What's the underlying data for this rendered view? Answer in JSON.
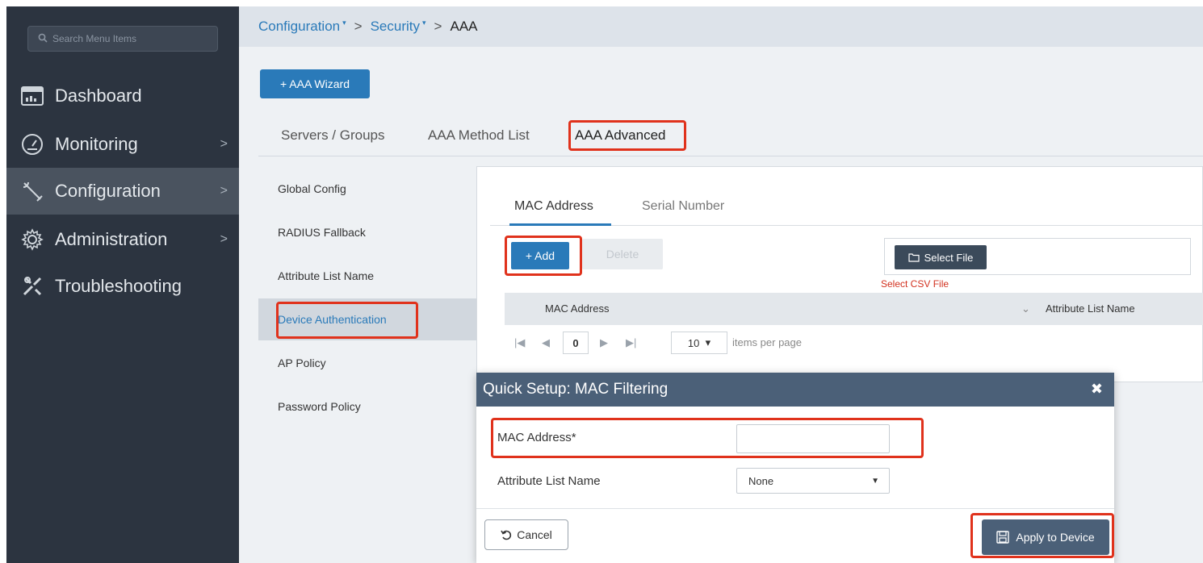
{
  "sidebar": {
    "search_placeholder": "Search Menu Items",
    "items": [
      {
        "label": "Dashboard",
        "icon": "dashboard-icon",
        "chevron": ""
      },
      {
        "label": "Monitoring",
        "icon": "gauge-icon",
        "chevron": ">"
      },
      {
        "label": "Configuration",
        "icon": "wrench-icon",
        "chevron": ">"
      },
      {
        "label": "Administration",
        "icon": "gear-icon",
        "chevron": ">"
      },
      {
        "label": "Troubleshooting",
        "icon": "tools-icon",
        "chevron": ""
      }
    ]
  },
  "breadcrumb": {
    "items": [
      "Configuration",
      "Security"
    ],
    "current": "AAA",
    "separator": ">"
  },
  "wizard_button": "+ AAA Wizard",
  "tabs": [
    "Servers / Groups",
    "AAA Method List",
    "AAA Advanced"
  ],
  "subnav": [
    "Global Config",
    "RADIUS Fallback",
    "Attribute List Name",
    "Device Authentication",
    "AP Policy",
    "Password Policy"
  ],
  "panel": {
    "inner_tabs": [
      "MAC Address",
      "Serial Number"
    ],
    "add_label": "+ Add",
    "delete_label": "Delete",
    "select_file_label": "Select File",
    "csv_hint": "Select CSV File",
    "columns": [
      "MAC Address",
      "Attribute List Name"
    ],
    "pager": {
      "first": "|◀",
      "prev": "◀",
      "page": "0",
      "next": "▶",
      "last": "▶|",
      "page_size": "10",
      "page_size_arrow": "▾",
      "items_label": "items per page"
    }
  },
  "modal": {
    "title": "Quick Setup: MAC Filtering",
    "close_glyph": "✖",
    "mac_label": "MAC Address*",
    "mac_value": "",
    "attr_label": "Attribute List Name",
    "attr_value": "None",
    "cancel_label": "Cancel",
    "apply_label": "Apply to Device"
  },
  "colors": {
    "sidebar_bg": "#2c3440",
    "accent": "#2a7ab9",
    "highlight": "#e0321c",
    "modal_header": "#4b6078"
  }
}
